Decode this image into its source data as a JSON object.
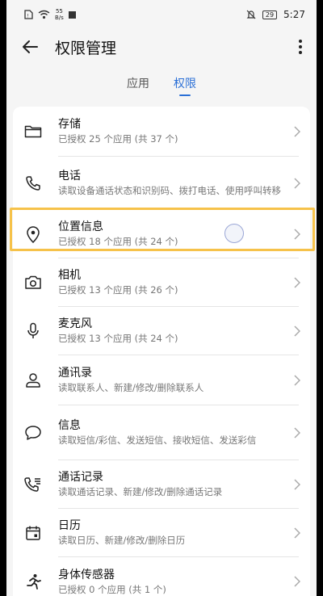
{
  "status": {
    "net_speed_value": "55",
    "net_speed_unit": "B/s",
    "battery": "29",
    "time": "5:27"
  },
  "header": {
    "title": "权限管理"
  },
  "tabs": [
    {
      "label": "应用",
      "active": false
    },
    {
      "label": "权限",
      "active": true
    }
  ],
  "colors": {
    "accent": "#2a6fd6",
    "highlight": "#f6c24a"
  },
  "items": [
    {
      "icon": "folder-icon",
      "title": "存储",
      "subtitle": "已授权 25 个应用 (共 37 个)"
    },
    {
      "icon": "phone-icon",
      "title": "电话",
      "subtitle": "读取设备通话状态和识别码、拨打电话、使用呼叫转移"
    },
    {
      "icon": "location-pin-icon",
      "title": "位置信息",
      "subtitle": "已授权 18 个应用 (共 24 个)"
    },
    {
      "icon": "camera-icon",
      "title": "相机",
      "subtitle": "已授权 13 个应用 (共 26 个)"
    },
    {
      "icon": "microphone-icon",
      "title": "麦克风",
      "subtitle": "已授权 13 个应用 (共 24 个)"
    },
    {
      "icon": "contacts-icon",
      "title": "通讯录",
      "subtitle": "读取联系人、新建/修改/删除联系人"
    },
    {
      "icon": "message-icon",
      "title": "信息",
      "subtitle": "读取短信/彩信、发送短信、接收短信、发送彩信"
    },
    {
      "icon": "call-log-icon",
      "title": "通话记录",
      "subtitle": "读取通话记录、新建/修改/删除通话记录"
    },
    {
      "icon": "calendar-icon",
      "title": "日历",
      "subtitle": "读取日历、新建/修改/删除日历"
    },
    {
      "icon": "body-sensor-icon",
      "title": "身体传感器",
      "subtitle": "已授权 0 个应用 (共 1 个)"
    }
  ]
}
